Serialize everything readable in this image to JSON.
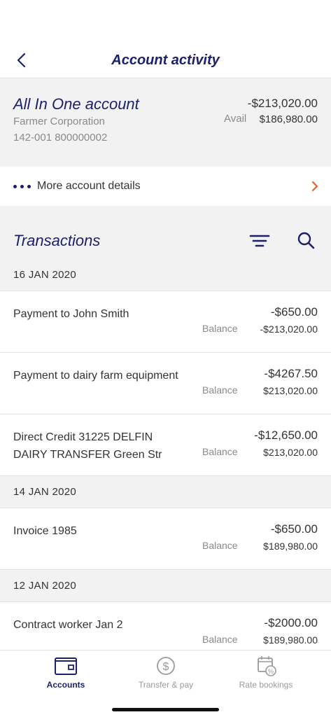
{
  "header": {
    "title": "Account activity"
  },
  "account": {
    "name": "All In One account",
    "owner": "Farmer Corporation",
    "number": "142-001 800000002",
    "balance": "-$213,020.00",
    "avail_label": "Avail",
    "avail_amount": "$186,980.00"
  },
  "more_details": {
    "label": "More account details"
  },
  "transactions": {
    "title": "Transactions",
    "groups": [
      {
        "date": "16 JAN 2020",
        "items": [
          {
            "description": "Payment to John Smith",
            "amount": "-$650.00",
            "balance_label": "Balance",
            "balance": "-$213,020.00"
          },
          {
            "description": "Payment to dairy farm equipment",
            "amount": "-$4267.50",
            "balance_label": "Balance",
            "balance": "$213,020.00"
          },
          {
            "description": "Direct Credit 31225 DELFIN DAIRY TRANSFER Green Str",
            "amount": "-$12,650.00",
            "balance_label": "Balance",
            "balance": "$213,020.00"
          }
        ]
      },
      {
        "date": "14 JAN 2020",
        "items": [
          {
            "description": "Invoice 1985",
            "amount": "-$650.00",
            "balance_label": "Balance",
            "balance": "$189,980.00"
          }
        ]
      },
      {
        "date": "12 JAN 2020",
        "items": [
          {
            "description": "Contract worker Jan 2",
            "amount": "-$2000.00",
            "balance_label": "Balance",
            "balance": "$189,980.00"
          }
        ]
      }
    ]
  },
  "tabbar": {
    "accounts": "Accounts",
    "transfer": "Transfer & pay",
    "rates": "Rate bookings"
  },
  "colors": {
    "primary": "#1c1f6b",
    "accent": "#e8612c",
    "muted": "#8a8a8a",
    "panel": "#f2f2f2"
  },
  "icons": [
    "back-chevron-icon",
    "dots-icon",
    "chevron-right-icon",
    "filter-icon",
    "search-icon",
    "wallet-icon",
    "dollar-circle-icon",
    "calendar-percent-icon"
  ]
}
